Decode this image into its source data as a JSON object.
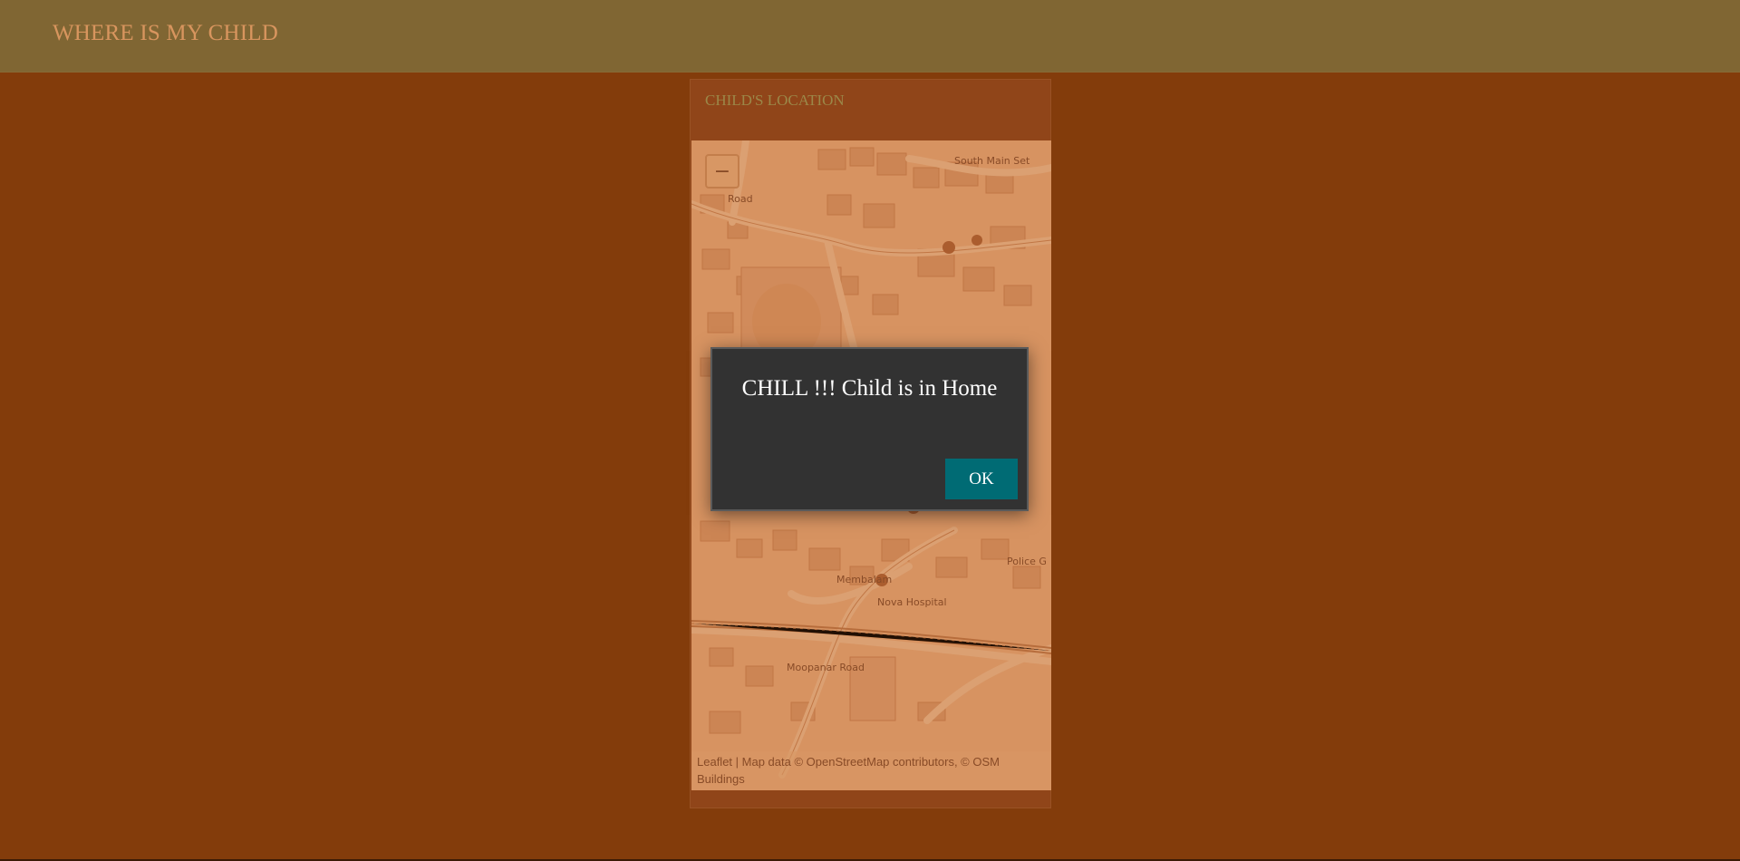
{
  "header": {
    "title": "WHERE IS MY CHILD"
  },
  "card": {
    "title": "CHILD'S LOCATION"
  },
  "map": {
    "labels": {
      "south_main_street": "South Main Set",
      "road_top_left": "Road",
      "membalam": "Membalam",
      "nova_hospital": "Nova Hospital",
      "moopanar_road": "Moopanar Road",
      "police": "Police G"
    },
    "attribution": "Leaflet | Map data © OpenStreetMap contributors, © OSM Buildings"
  },
  "dialog": {
    "message": "CHILL !!! Child is in Home",
    "ok_label": "OK"
  },
  "colors": {
    "background": "#833c0b",
    "header": "#7f7541",
    "title": "#f5b37a",
    "dialog": "#323232",
    "button": "#006b74"
  }
}
